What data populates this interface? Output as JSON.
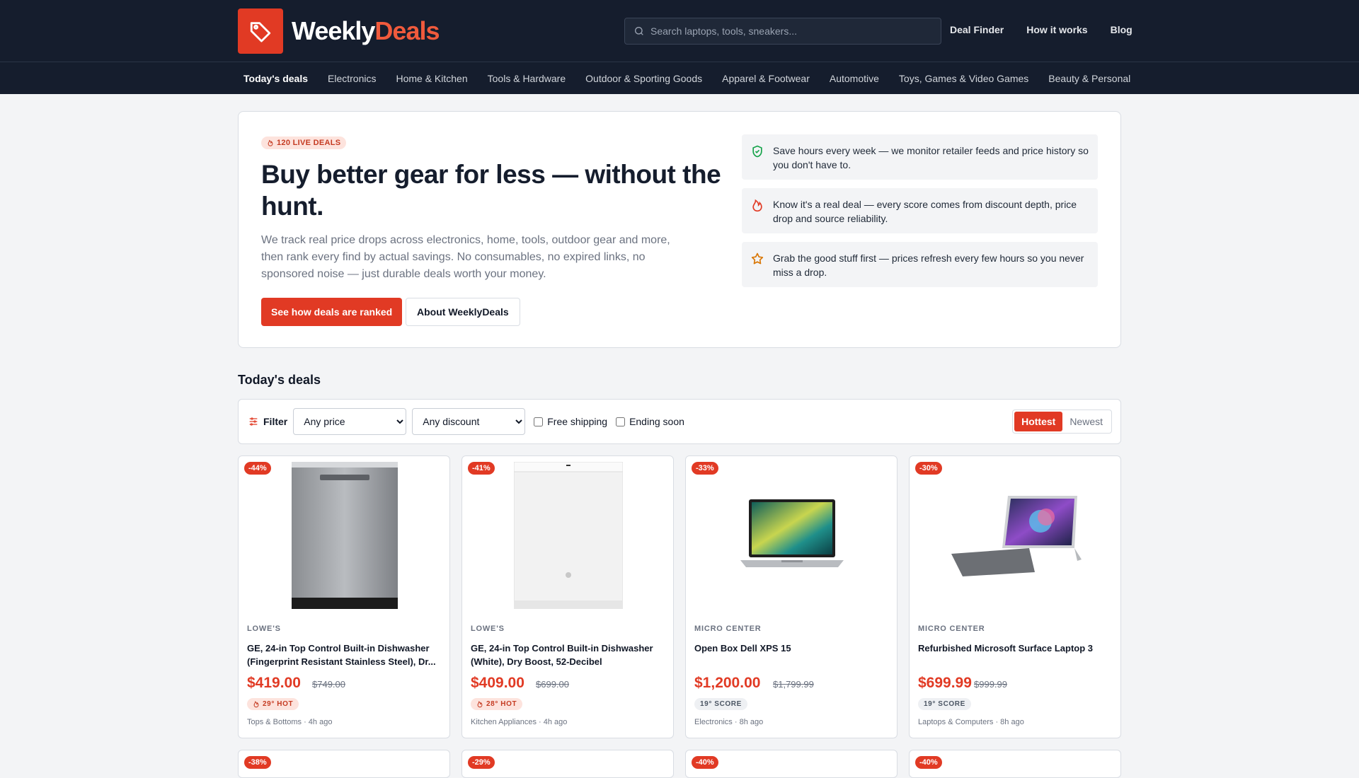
{
  "brand": {
    "part1": "Weekly",
    "part2": "Deals",
    "accent": "#e13a24",
    "navy": "#151d2d"
  },
  "search": {
    "placeholder": "Search laptops, tools, sneakers..."
  },
  "topnav": [
    "Deal Finder",
    "How it works",
    "Blog"
  ],
  "categories": [
    "Today's deals",
    "Electronics",
    "Home & Kitchen",
    "Tools & Hardware",
    "Outdoor & Sporting Goods",
    "Apparel & Footwear",
    "Automotive",
    "Toys, Games & Video Games",
    "Beauty & Personal"
  ],
  "hero": {
    "badge": "120 LIVE DEALS",
    "title": "Buy better gear for less — without the hunt.",
    "body": "We track real price drops across electronics, home, tools, outdoor gear and more, then rank every find by actual savings. No consumables, no expired links, no sponsored noise — just durable deals worth your money.",
    "primary_button": "See how deals are ranked",
    "secondary_button": "About WeeklyDeals",
    "features": [
      {
        "icon": "shield-check-icon",
        "text": "Save hours every week — we monitor retailer feeds and price history so you don't have to."
      },
      {
        "icon": "flame-icon",
        "text": "Know it's a real deal — every score comes from discount depth, price drop and source reliability."
      },
      {
        "icon": "star-icon",
        "text": "Grab the good stuff first — prices refresh every few hours so you never miss a drop."
      }
    ]
  },
  "deals_section": {
    "title": "Today's deals",
    "filter_label": "Filter",
    "price_select": "Any price",
    "discount_select": "Any discount",
    "free_shipping": "Free shipping",
    "ending_soon": "Ending soon",
    "sort_hottest": "Hottest",
    "sort_newest": "Newest"
  },
  "deals": [
    {
      "discount": "-44%",
      "store": "LOWE'S",
      "title": "GE, 24-in Top Control Built-in Dishwasher (Fingerprint Resistant Stainless Steel), Dr...",
      "price": "$419.00",
      "old_price": "$749.00",
      "tag": "29° HOT",
      "tag_type": "hot",
      "meta": "Tops & Bottoms · 4h ago",
      "image": "dishwasher-steel"
    },
    {
      "discount": "-41%",
      "store": "LOWE'S",
      "title": "GE, 24-in Top Control Built-in Dishwasher (White), Dry Boost, 52-Decibel",
      "price": "$409.00",
      "old_price": "$699.00",
      "tag": "28° HOT",
      "tag_type": "hot",
      "meta": "Kitchen Appliances · 4h ago",
      "image": "dishwasher-white"
    },
    {
      "discount": "-33%",
      "store": "MICRO CENTER",
      "title": "Open Box Dell XPS 15",
      "price": "$1,200.00",
      "old_price": "$1,799.99",
      "tag": "19° SCORE",
      "tag_type": "score",
      "meta": "Electronics · 8h ago",
      "image": "laptop"
    },
    {
      "discount": "-30%",
      "store": "MICRO CENTER",
      "title": "Refurbished Microsoft Surface Laptop 3",
      "price": "$699.99",
      "old_price": "$999.99",
      "tag": "19° SCORE",
      "tag_type": "score",
      "meta": "Laptops & Computers · 8h ago",
      "image": "surface"
    }
  ],
  "next_row_discounts": [
    "-38%",
    "-29%",
    "-40%",
    "-40%"
  ]
}
